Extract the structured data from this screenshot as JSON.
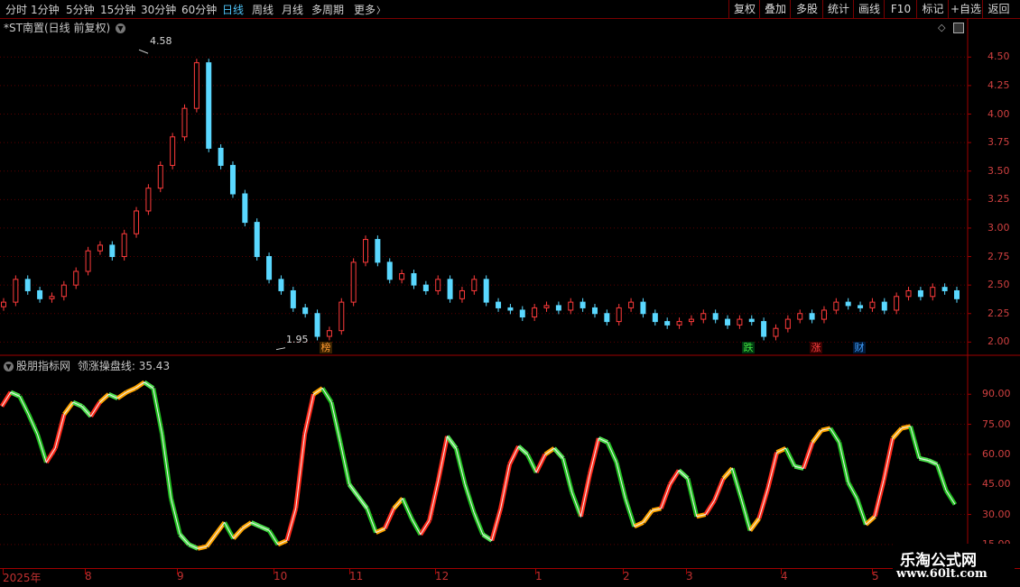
{
  "toolbar": {
    "periods": [
      "分时",
      "1分钟",
      "5分钟",
      "15分钟",
      "30分钟",
      "60分钟",
      "日线",
      "周线",
      "月线",
      "多周期",
      "更多"
    ],
    "active_period": "日线",
    "more_arrow": "〉",
    "buttons": [
      "复权",
      "叠加",
      "多股",
      "统计",
      "画线",
      "F10",
      "标记",
      "+自选",
      "返回"
    ]
  },
  "main_panel": {
    "title": "*ST南置(日线 前复权)",
    "high_label": "4.58",
    "low_label": "1.95",
    "y_ticks": [
      "4.50",
      "4.25",
      "4.00",
      "3.75",
      "3.50",
      "3.25",
      "3.00",
      "2.75",
      "2.50",
      "2.25",
      "2.00"
    ],
    "events": [
      {
        "label": "榜",
        "color": "#e07820"
      },
      {
        "label": "跌",
        "color": "#28c028"
      },
      {
        "label": "涨",
        "color": "#e03030"
      },
      {
        "label": "财",
        "color": "#3a90e0"
      }
    ]
  },
  "indicator_panel": {
    "title": "股朋指标网",
    "line_name": "领涨操盘线:",
    "value": "35.43",
    "y_ticks": [
      "90.00",
      "75.00",
      "60.00",
      "45.00",
      "30.00",
      "15.00"
    ]
  },
  "time_axis": {
    "labels": [
      "2025年",
      "8",
      "9",
      "10",
      "11",
      "12",
      "1",
      "2",
      "3",
      "4",
      "5"
    ]
  },
  "watermark": {
    "line1": "乐淘公式网",
    "line2": "www.60lt.com"
  },
  "colors": {
    "up": "#ff3b3b",
    "down": "#5ad8ff",
    "grid": "#5a0000",
    "axis_text": "#d04040",
    "indicator_up": "#ffa500",
    "indicator_down": "#1fbf1f"
  },
  "chart_data": [
    {
      "type": "candlestick",
      "title": "*ST南置(日线 前复权)",
      "ylim": [
        1.9,
        4.7
      ],
      "y_ticks": [
        4.5,
        4.25,
        4.0,
        3.75,
        3.5,
        3.25,
        3.0,
        2.75,
        2.5,
        2.25,
        2.0
      ],
      "high": 4.58,
      "low": 1.95,
      "x_labels": [
        "2025年",
        "8",
        "9",
        "10",
        "11",
        "12",
        "1",
        "2",
        "3",
        "4",
        "5"
      ],
      "close_series": [
        2.35,
        2.55,
        2.45,
        2.38,
        2.4,
        2.5,
        2.62,
        2.8,
        2.85,
        2.75,
        2.95,
        3.15,
        3.35,
        3.55,
        3.8,
        4.05,
        4.45,
        3.7,
        3.55,
        3.3,
        3.05,
        2.75,
        2.55,
        2.45,
        2.3,
        2.25,
        2.05,
        2.1,
        2.35,
        2.7,
        2.9,
        2.7,
        2.55,
        2.6,
        2.5,
        2.45,
        2.55,
        2.38,
        2.45,
        2.55,
        2.35,
        2.3,
        2.28,
        2.22,
        2.3,
        2.32,
        2.28,
        2.35,
        2.3,
        2.25,
        2.18,
        2.3,
        2.35,
        2.25,
        2.18,
        2.15,
        2.18,
        2.2,
        2.25,
        2.2,
        2.15,
        2.2,
        2.18,
        2.05,
        2.12,
        2.2,
        2.25,
        2.2,
        2.28,
        2.35,
        2.32,
        2.3,
        2.35,
        2.28,
        2.4,
        2.45,
        2.4,
        2.48,
        2.45,
        2.38
      ]
    },
    {
      "type": "line",
      "title": "股朋指标网 领涨操盘线",
      "series_name": "领涨操盘线",
      "last_value": 35.43,
      "ylim": [
        10,
        100
      ],
      "y_ticks": [
        90,
        75,
        60,
        45,
        30,
        15
      ],
      "values": [
        84,
        91,
        89,
        80,
        70,
        56,
        63,
        80,
        86,
        84,
        79,
        86,
        90,
        88,
        91,
        93,
        96,
        93,
        70,
        38,
        20,
        15,
        13,
        14,
        20,
        26,
        18,
        23,
        26,
        24,
        22,
        15,
        17,
        33,
        70,
        90,
        93,
        86,
        66,
        45,
        39,
        33,
        21,
        23,
        33,
        38,
        28,
        20,
        27,
        47,
        69,
        63,
        45,
        31,
        20,
        17,
        33,
        55,
        64,
        60,
        51,
        60,
        63,
        58,
        41,
        29,
        50,
        68,
        66,
        56,
        38,
        24,
        26,
        32,
        33,
        45,
        52,
        48,
        29,
        30,
        37,
        48,
        53,
        38,
        22,
        28,
        43,
        61,
        63,
        54,
        53,
        66,
        72,
        73,
        66,
        46,
        38,
        25,
        29,
        47,
        68,
        73,
        74,
        58,
        57,
        55,
        42,
        35
      ]
    }
  ]
}
